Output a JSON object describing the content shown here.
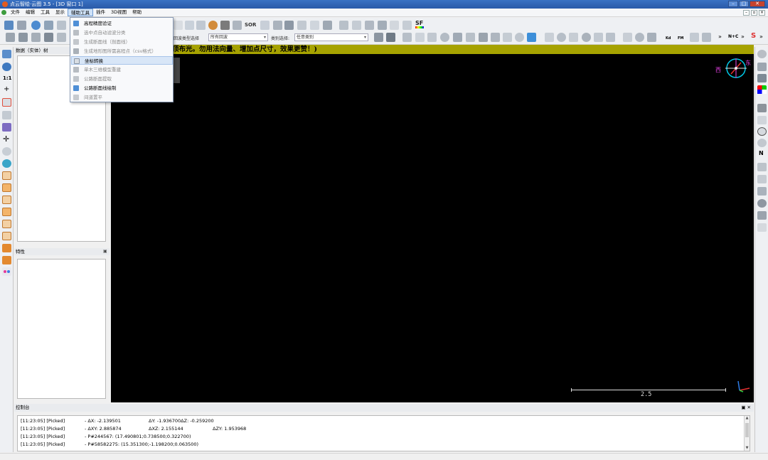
{
  "window": {
    "title": "点云智绘·云图 3.5 - [3D 窗口 1]"
  },
  "menu": {
    "items": [
      "文件",
      "编辑",
      "工具",
      "显示",
      "辅助工具",
      "插件",
      "3D视图",
      "帮助"
    ],
    "active_index": 4
  },
  "toolbar": {
    "sor_label": "SOR",
    "sf_label": "SF",
    "filter_label": "回波类型选择",
    "filter_value": "所有回波",
    "class_label": "类别选择:",
    "class_value": "任意类别",
    "kd_label": "Kd",
    "fm_label": "FM",
    "nc_label": "N+C"
  },
  "dropdown": {
    "items": [
      {
        "label": "高程精度验证",
        "enabled": true
      },
      {
        "label": "选中点自动滤波分类",
        "enabled": false
      },
      {
        "label": "生成断面线（剖面线）",
        "enabled": false
      },
      {
        "label": "生成地形图所需高程点（csv格式）",
        "enabled": false
      },
      {
        "label": "坐标转换",
        "enabled": true
      },
      {
        "label": "单木三维模型重建",
        "enabled": false
      },
      {
        "label": "公路断面提取",
        "enabled": false
      },
      {
        "label": "公路断面线绘制",
        "enabled": true
      },
      {
        "label": "间道置平",
        "enabled": false
      }
    ],
    "hover_index": 4
  },
  "panels": {
    "tree_title": "数据（实体）树",
    "prop_title": "特性",
    "console_title": "控制台"
  },
  "viewport": {
    "banner": "顶布光。勿用法向量、增加点尺寸，效果更赞！)",
    "scale_label": "2.5",
    "compass_west": "西",
    "compass_east": "东"
  },
  "console": {
    "rows": [
      {
        "time": "[11:23:05] [Picked]",
        "a": "- ΔX: -2.139501",
        "b": "ΔY: -1.936700ΔZ: -0.259200",
        "c": ""
      },
      {
        "time": "[11:23:05] [Picked]",
        "a": "- ΔXY: 2.885874",
        "b": "ΔXZ: 2.155144",
        "c": "ΔZY: 1.953968"
      },
      {
        "time": "[11:23:05] [Picked]",
        "a": "- P#244567: (17.490801;0.738500;0.322700)",
        "b": "",
        "c": ""
      },
      {
        "time": "[11:23:05] [Picked]",
        "a": "- P#58582275: (15.351300;-1.198200;0.063500)",
        "b": "",
        "c": ""
      }
    ]
  },
  "colors": {
    "banner": "#a6a200",
    "viewport": "#000000",
    "accent": "#2a5aa8"
  }
}
